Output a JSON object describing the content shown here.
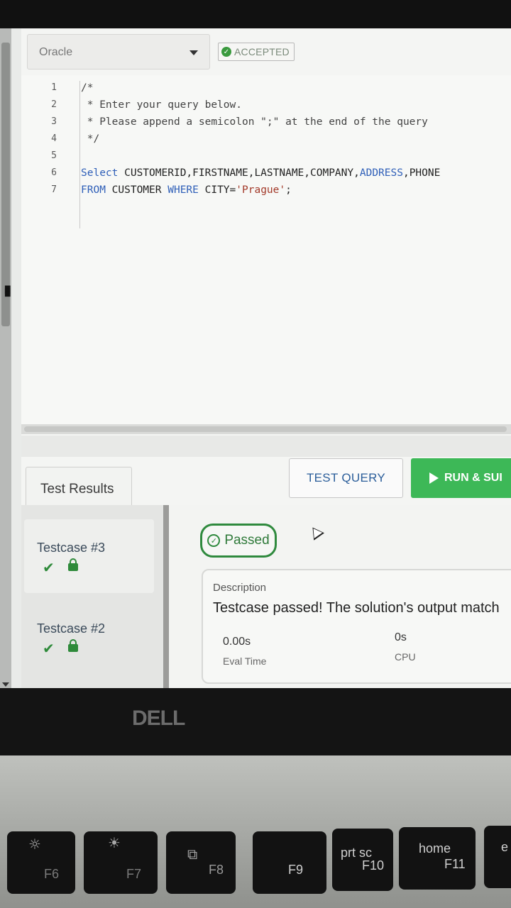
{
  "editor": {
    "language": "Oracle",
    "status": "ACCEPTED",
    "lines": [
      {
        "n": "1",
        "text": "/*"
      },
      {
        "n": "2",
        "text": " * Enter your query below."
      },
      {
        "n": "3",
        "text": " * Please append a semicolon \";\" at the end of the query"
      },
      {
        "n": "4",
        "text": " */"
      },
      {
        "n": "5",
        "text": ""
      },
      {
        "n": "6",
        "text": "Select CUSTOMERID,FIRSTNAME,LASTNAME,COMPANY,ADDRESS,PHONE"
      },
      {
        "n": "7",
        "text": "FROM CUSTOMER WHERE CITY='Prague';"
      }
    ],
    "code6": {
      "kw": "Select",
      "fields": " CUSTOMERID,FIRSTNAME,LASTNAME,COMPANY,",
      "kw2": "ADDRESS",
      "tail": ",PHONE"
    },
    "code7": {
      "kw": "FROM",
      "mid": " CUSTOMER ",
      "kw2": "WHERE",
      "mid2": " CITY=",
      "str": "'Prague'",
      "end": ";"
    }
  },
  "actions": {
    "test_query": "TEST QUERY",
    "run_submit": "RUN & SUI"
  },
  "results": {
    "tab_label": "Test Results",
    "testcases": [
      {
        "name": "Testcase #3"
      },
      {
        "name": "Testcase #2"
      }
    ],
    "status": "Passed",
    "description_label": "Description",
    "description_text": "Testcase passed! The solution's output match",
    "eval_time_value": "0.00s",
    "eval_time_label": "Eval Time",
    "cpu_value": "0s",
    "cpu_label": "CPU"
  },
  "laptop": {
    "brand": "DELL",
    "keys": [
      {
        "label": "F6",
        "icon": "brightness-down-icon"
      },
      {
        "label": "F7",
        "icon": "brightness-up-icon"
      },
      {
        "label": "F8",
        "icon": "display-switch-icon"
      },
      {
        "label": "F9"
      },
      {
        "top": "prt sc",
        "label": "F10"
      },
      {
        "top": "home",
        "label": "F11"
      },
      {
        "top": "e"
      }
    ]
  }
}
